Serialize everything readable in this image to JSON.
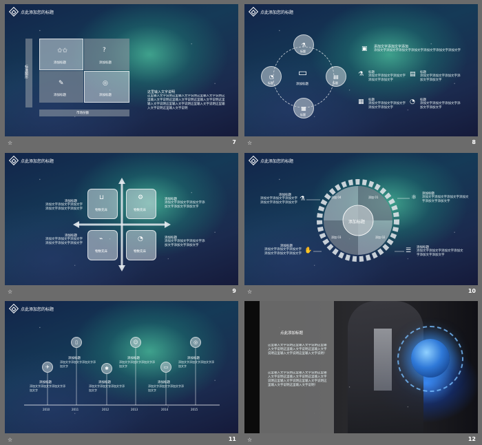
{
  "header_title": "点此添加您的标题",
  "slides": [
    {
      "page": "7",
      "side_label": "标准图形",
      "quad_labels": [
        "添加标题",
        "添加标题",
        "添加标题",
        "添加标题"
      ],
      "bottom_bar": "市场份额",
      "title": "这里输入文字说明",
      "body": "这里输入文字说明这里输入文字说明这里输入文字说明这里输入文字说明这里输入文字说明这里输入文字说明这里输入文字说明这里输入文字说明这里输入文字说明这里输入文字说明这里输入文字说明"
    },
    {
      "page": "8",
      "cycle_labels": [
        "标题",
        "标题",
        "标题",
        "标题"
      ],
      "center_label": "添加标题",
      "top_title": "添加文字添加文字添加",
      "top_body": "添加文字添加文字添加文字添加文字添加文字添加文字添加文字",
      "items": [
        {
          "title": "标题",
          "body": "添加文字添加文字添加文字添加文字添加文字"
        },
        {
          "title": "标题",
          "body": "添加文字添加文字添加文字添加文字添加文字"
        },
        {
          "title": "标题",
          "body": "添加文字添加文字添加文字添加文字添加文字"
        },
        {
          "title": "标题",
          "body": "添加文字添加文字添加文字添加文字添加文字"
        }
      ]
    },
    {
      "page": "9",
      "tiles": [
        "物数充床",
        "物数充床",
        "物数充床",
        "物数充床"
      ],
      "texts": [
        {
          "title": "添加标题",
          "body": "添加文字添加文字添加文字添加文字添加文字添加文字"
        },
        {
          "title": "添加标题",
          "body": "添加文字添加文字添加文字添加文字添加文字添加文字"
        },
        {
          "title": "添加标题",
          "body": "添加文字添加文字添加文字添加文字添加文字添加文字"
        },
        {
          "title": "添加标题",
          "body": "添加文字添加文字添加文字添加文字添加文字添加文字"
        }
      ]
    },
    {
      "page": "10",
      "center": "添加标题",
      "segments": [
        "添加 01",
        "添加 02",
        "添加 03",
        "添加 04"
      ],
      "texts": [
        {
          "title": "添加标题",
          "body": "添加文字添加文字添加文字添加文字添加文字添加文字"
        },
        {
          "title": "添加标题",
          "body": "添加文字添加文字添加文字添加文字添加文字添加文字"
        },
        {
          "title": "添加标题",
          "body": "添加文字添加文字添加文字添加文字添加文字添加文字"
        },
        {
          "title": "添加标题",
          "body": "添加文字添加文字添加文字添加文字添加文字添加文字"
        }
      ]
    },
    {
      "page": "11",
      "years": [
        "2010",
        "2011",
        "2012",
        "2013",
        "2014",
        "2015"
      ],
      "texts": [
        {
          "title": "添加标题",
          "body": "添加文字添加文字添加文字添加文字"
        },
        {
          "title": "添加标题",
          "body": "添加文字添加文字添加文字添加文字"
        },
        {
          "title": "添加标题",
          "body": "添加文字添加文字添加文字添加文字"
        },
        {
          "title": "添加标题",
          "body": "添加文字添加文字添加文字添加文字"
        },
        {
          "title": "添加标题",
          "body": "添加文字添加文字添加文字添加文字"
        },
        {
          "title": "添加标题",
          "body": "添加文字添加文字添加文字添加文字"
        }
      ]
    },
    {
      "page": "12",
      "title": "点此添加标题",
      "body1": "这里输入文字说明这里输入文字说明这里输入文字说明这里输入文字说明这里输入文字说明这里输入文字说明这里输入文字说明！",
      "body2": "这里输入文字说明这里输入文字说明这里输入文字说明这里输入文字说明这里输入文字说明这里输入文字说明这里输入文字说明这里输入文字说明这里输入文字说明！"
    }
  ]
}
